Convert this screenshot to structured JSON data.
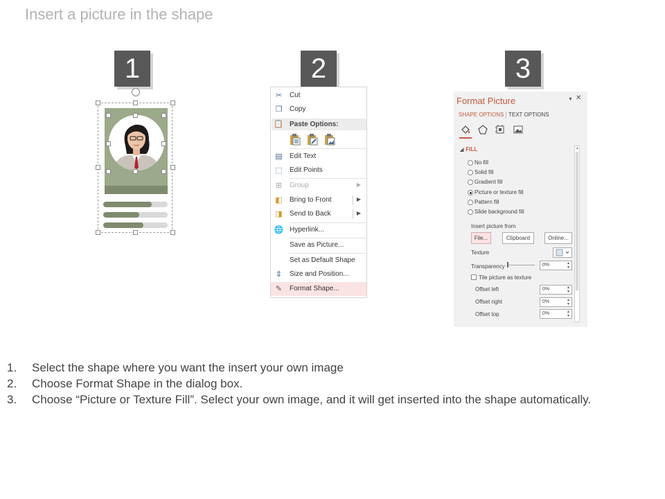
{
  "page": {
    "title": "Insert a picture in the shape"
  },
  "steps": [
    "1",
    "2",
    "3"
  ],
  "progress_bars": [
    0.75,
    0.56,
    0.62
  ],
  "colors": {
    "card": "#9ca98a",
    "card_band": "#7f8b6e",
    "badge": "#585858",
    "accent": "#c55a3b",
    "highlight": "#fbe3e3"
  },
  "context_menu": {
    "items": [
      {
        "label": "Cut",
        "icon": "scissors-icon"
      },
      {
        "label": "Copy",
        "icon": "copy-icon"
      },
      {
        "label": "Paste Options:",
        "icon": "paste-icon"
      },
      {
        "label": "Edit Text",
        "icon": "edit-text-icon"
      },
      {
        "label": "Edit Points",
        "icon": "edit-points-icon"
      },
      {
        "label": "Group",
        "icon": "group-icon"
      },
      {
        "label": "Bring to Front",
        "icon": "bring-front-icon"
      },
      {
        "label": "Send to Back",
        "icon": "send-back-icon"
      },
      {
        "label": "Hyperlink...",
        "icon": "hyperlink-icon"
      },
      {
        "label": "Save as Picture..."
      },
      {
        "label": "Set as Default Shape"
      },
      {
        "label": "Size and Position...",
        "icon": "size-position-icon"
      },
      {
        "label": "Format Shape...",
        "icon": "format-shape-icon"
      }
    ]
  },
  "format_picture": {
    "title": "Format Picture",
    "tabs": [
      "SHAPE OPTIONS",
      "TEXT OPTIONS"
    ],
    "section": "FILL",
    "fill_options": [
      "No fill",
      "Solid fill",
      "Gradient fill",
      "Picture or texture fill",
      "Pattern fill",
      "Slide background fill"
    ],
    "selected_fill": "Picture or texture fill",
    "insert_from": "Insert picture from",
    "buttons": [
      "File...",
      "Clipboard",
      "Online..."
    ],
    "texture_label": "Texture",
    "transparency_label": "Transparency",
    "transparency_value": "0%",
    "tile_label": "Tile picture as texture",
    "offsets": [
      {
        "label": "Offset left",
        "value": "0%"
      },
      {
        "label": "Offset right",
        "value": "0%"
      },
      {
        "label": "Offset top",
        "value": "0%"
      }
    ]
  },
  "instructions": [
    {
      "num": "1.",
      "text": "Select the shape where you want the insert your own image"
    },
    {
      "num": "2.",
      "text": "Choose Format Shape in the dialog box."
    },
    {
      "num": "3.",
      "text": "Choose “Picture or Texture Fill”. Select your own image, and it will get inserted into the shape automatically."
    }
  ]
}
